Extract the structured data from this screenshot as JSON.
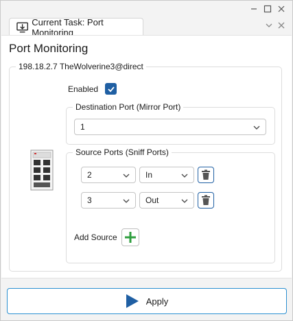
{
  "tab": {
    "title": "Current Task: Port Monitoring"
  },
  "page": {
    "title": "Port Monitoring"
  },
  "device": {
    "label": "198.18.2.7 TheWolverine3@direct"
  },
  "enabled": {
    "label": "Enabled",
    "checked": true
  },
  "destination": {
    "legend": "Destination Port (Mirror Port)",
    "value": "1"
  },
  "sources": {
    "legend": "Source Ports (Sniff Ports)",
    "rows": [
      {
        "port": "2",
        "direction": "In"
      },
      {
        "port": "3",
        "direction": "Out"
      }
    ],
    "add_label": "Add Source"
  },
  "apply": {
    "label": "Apply"
  },
  "colors": {
    "accent": "#1f5fa3",
    "add_green": "#2e9e3e",
    "apply_border": "#2a8fd1"
  }
}
